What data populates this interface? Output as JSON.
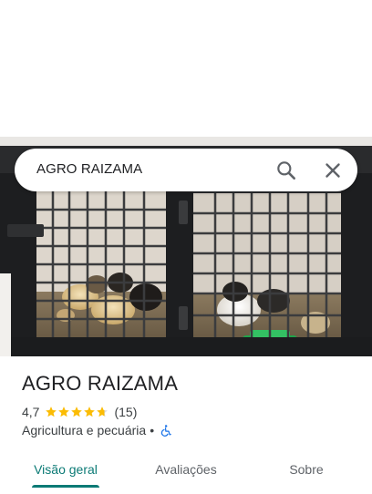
{
  "search": {
    "query": "AGRO RAIZAMA",
    "search_icon": "search-icon",
    "close_icon": "close-icon"
  },
  "place": {
    "name": "AGRO RAIZAMA",
    "rating": "4,7",
    "stars_value": 4.7,
    "stars_max": 5,
    "review_count": "(15)",
    "category": "Agricultura e pecuária",
    "separator": "•",
    "accessibility_icon": "wheelchair-icon"
  },
  "tabs": [
    {
      "label": "Visão geral",
      "active": true
    },
    {
      "label": "Avaliações",
      "active": false
    },
    {
      "label": "Sobre",
      "active": false
    }
  ],
  "colors": {
    "accent": "#0b7a75",
    "star": "#fbbc04",
    "accessibility": "#1a73e8",
    "text": "#202124",
    "secondary_text": "#3c4043"
  }
}
